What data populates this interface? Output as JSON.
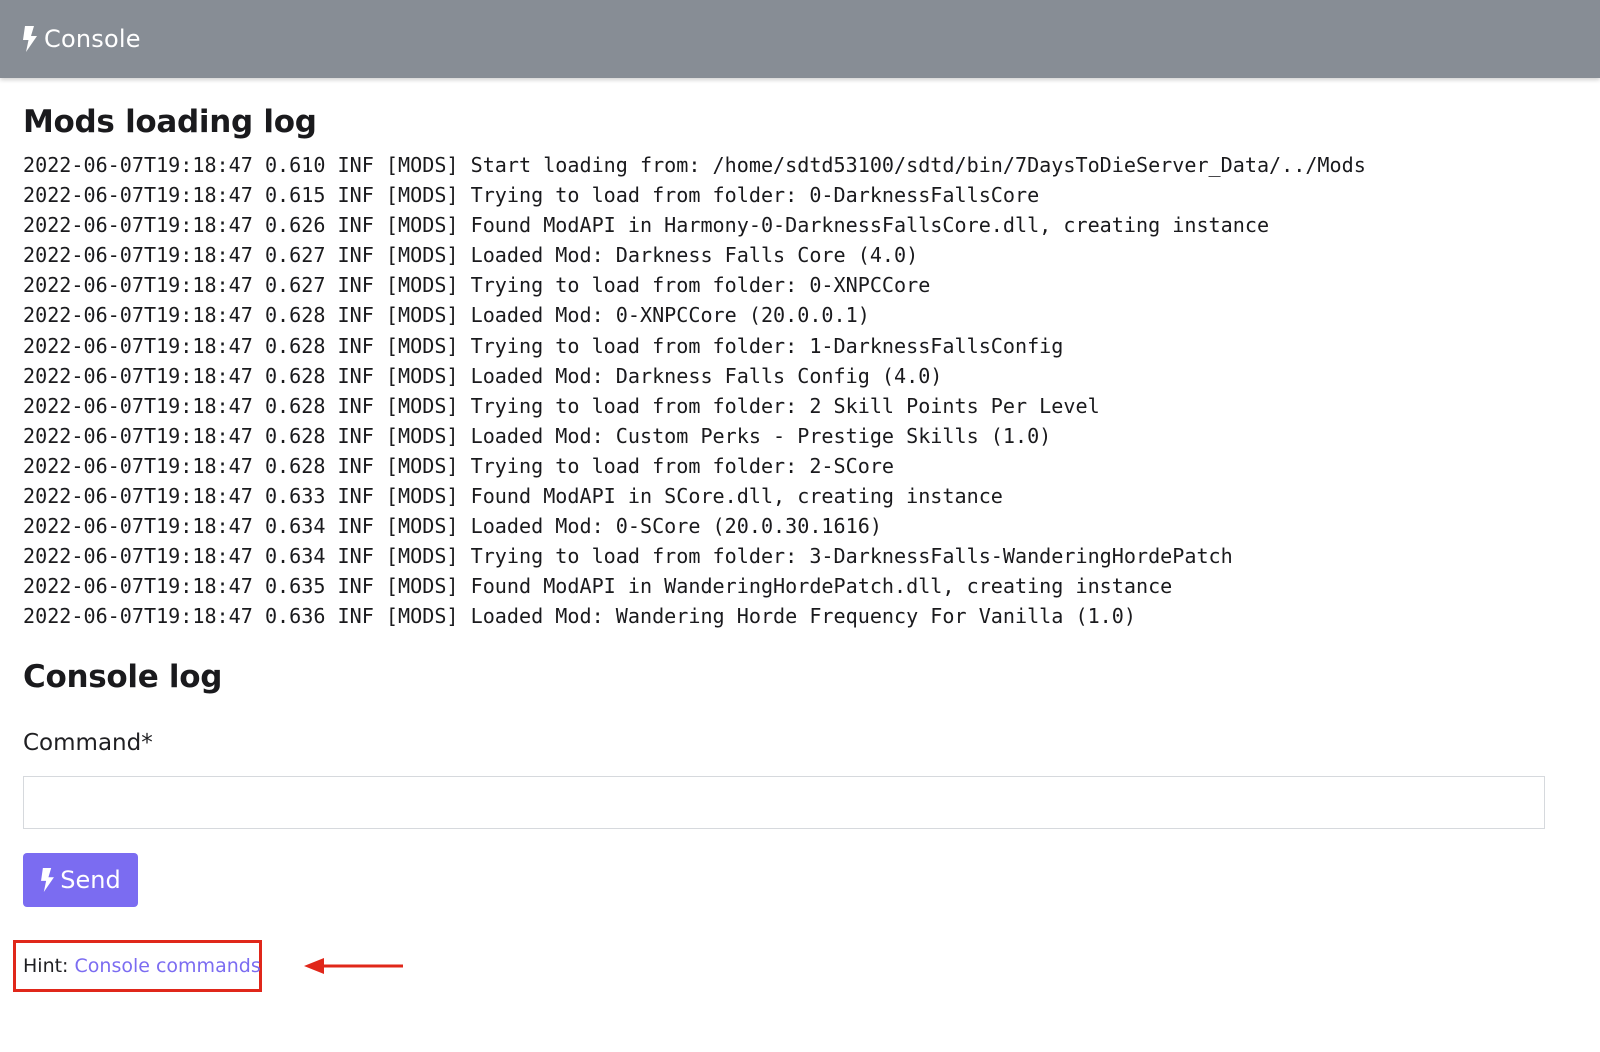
{
  "header": {
    "title": "Console",
    "icon": "lightning-bolt-icon",
    "bg_color": "#878d95"
  },
  "mods_log": {
    "title": "Mods loading log",
    "lines": [
      "2022-06-07T19:18:47 0.610 INF [MODS] Start loading from: /home/sdtd53100/sdtd/bin/7DaysToDieServer_Data/../Mods",
      "2022-06-07T19:18:47 0.615 INF [MODS] Trying to load from folder: 0-DarknessFallsCore",
      "2022-06-07T19:18:47 0.626 INF [MODS] Found ModAPI in Harmony-0-DarknessFallsCore.dll, creating instance",
      "2022-06-07T19:18:47 0.627 INF [MODS] Loaded Mod: Darkness Falls Core (4.0)",
      "2022-06-07T19:18:47 0.627 INF [MODS] Trying to load from folder: 0-XNPCCore",
      "2022-06-07T19:18:47 0.628 INF [MODS] Loaded Mod: 0-XNPCCore (20.0.0.1)",
      "2022-06-07T19:18:47 0.628 INF [MODS] Trying to load from folder: 1-DarknessFallsConfig",
      "2022-06-07T19:18:47 0.628 INF [MODS] Loaded Mod: Darkness Falls Config (4.0)",
      "2022-06-07T19:18:47 0.628 INF [MODS] Trying to load from folder: 2 Skill Points Per Level",
      "2022-06-07T19:18:47 0.628 INF [MODS] Loaded Mod: Custom Perks - Prestige Skills (1.0)",
      "2022-06-07T19:18:47 0.628 INF [MODS] Trying to load from folder: 2-SCore",
      "2022-06-07T19:18:47 0.633 INF [MODS] Found ModAPI in SCore.dll, creating instance",
      "2022-06-07T19:18:47 0.634 INF [MODS] Loaded Mod: 0-SCore (20.0.30.1616)",
      "2022-06-07T19:18:47 0.634 INF [MODS] Trying to load from folder: 3-DarknessFalls-WanderingHordePatch",
      "2022-06-07T19:18:47 0.635 INF [MODS] Found ModAPI in WanderingHordePatch.dll, creating instance",
      "2022-06-07T19:18:47 0.636 INF [MODS] Loaded Mod: Wandering Horde Frequency For Vanilla (1.0)"
    ]
  },
  "console_log": {
    "title": "Console log",
    "command_label": "Command*",
    "command_value": "",
    "send_label": "Send",
    "send_icon": "lightning-bolt-icon",
    "send_color": "#7b6cf1"
  },
  "hint": {
    "prefix": "Hint:",
    "link_text": "Console commands",
    "highlight_color": "#e0271a"
  }
}
